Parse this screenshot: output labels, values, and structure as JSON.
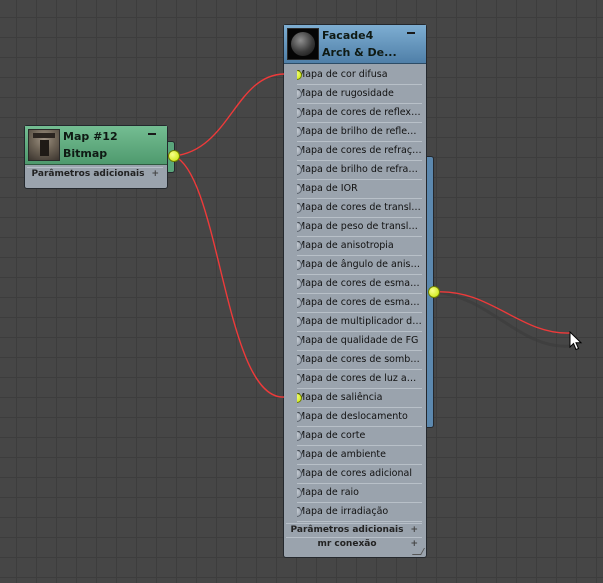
{
  "canvas": {
    "background": "#464646",
    "grid_color": "#3d3d3d",
    "wire_color": "#ee3a3a",
    "socket_color": "#d9f51e"
  },
  "bitmap_node": {
    "name": "Map #12",
    "type": "Bitmap",
    "header_color": "#5fac7e",
    "rollout": "Parâmetros adicionais"
  },
  "material_node": {
    "name": "Facade4",
    "type": "Arch & De...",
    "header_color": "#6596c0",
    "slots": [
      "Mapa de cor difusa",
      "Mapa de rugosidade",
      "Mapa de cores de reflexão",
      "Mapa de brilho de reflexão",
      "Mapa de cores de refração",
      "Mapa de brilho de refração",
      "Mapa de IOR",
      "Mapa de cores de translu...",
      "Mapa de peso de translu...",
      "Mapa de anisotropia",
      "Mapa de ângulo de aniso...",
      "Mapa de cores de esmae...",
      "Mapa de cores de esmae...",
      "Mapa de multiplicador de...",
      "Mapa de qualidade de FG",
      "Mapa de cores de sombr...",
      "Mapa de cores de luz am...",
      "Mapa de saliência",
      "Mapa de deslocamento",
      "Mapa de corte",
      "Mapa de ambiente",
      "Mapa de cores adicional",
      "Mapa de raio",
      "Mapa de irradiação"
    ],
    "connected_slots": [
      "Mapa de cor difusa",
      "Mapa de saliência"
    ],
    "rollouts": [
      "Parâmetros adicionais",
      "mr conexão"
    ]
  }
}
